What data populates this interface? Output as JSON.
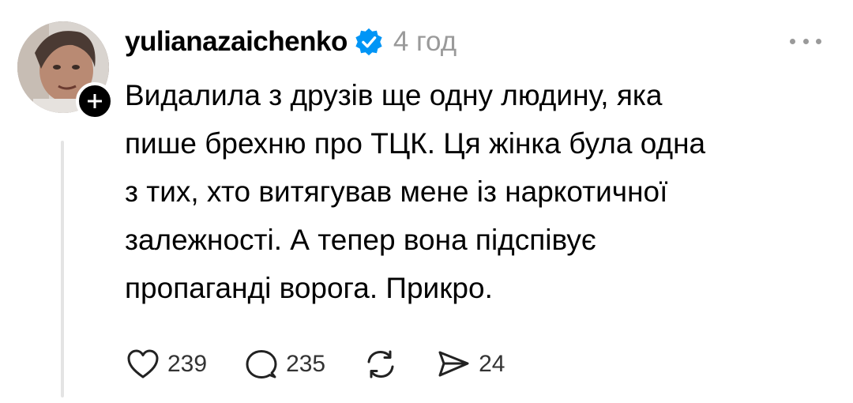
{
  "post": {
    "username": "yulianazaichenko",
    "time": "4 год",
    "text": "Видалила з друзів ще одну людину, яка\nпише брехню про ТЦК. Ця жінка була одна\nз тих, хто витягував мене із наркотичної\nзалежності. А тепер вона підспівує\nпропаганді ворога. Прикро.",
    "actions": {
      "likes": "239",
      "comments": "235",
      "shares": "24"
    }
  },
  "colors": {
    "verified": "#0095f6",
    "meta_text": "#9a9a9a",
    "thread_line": "#e4e4e4"
  },
  "icons": [
    "heart-icon",
    "comment-icon",
    "repost-icon",
    "share-icon",
    "verified-icon",
    "more-icon",
    "plus-icon"
  ]
}
